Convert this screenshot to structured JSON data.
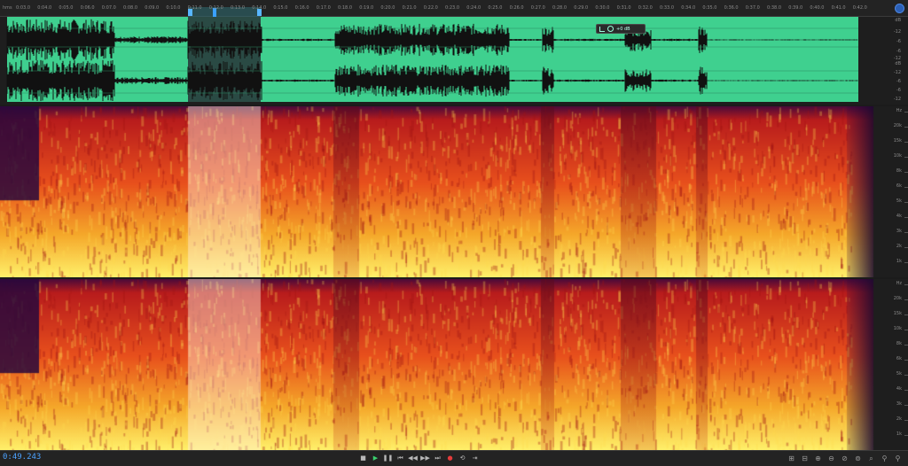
{
  "ruler": {
    "unit_label": "hms",
    "ticks": [
      {
        "label": "0:03.0"
      },
      {
        "label": "0:04.0"
      },
      {
        "label": "0:05.0"
      },
      {
        "label": "0:06.0"
      },
      {
        "label": "0:07.0"
      },
      {
        "label": "0:08.0"
      },
      {
        "label": "0:09.0"
      },
      {
        "label": "0:10.0"
      },
      {
        "label": "0:11.0"
      },
      {
        "label": "0:12.0"
      },
      {
        "label": "0:13.0"
      },
      {
        "label": "0:14.0"
      },
      {
        "label": "0:15.0"
      },
      {
        "label": "0:16.0"
      },
      {
        "label": "0:17.0"
      },
      {
        "label": "0:18.0"
      },
      {
        "label": "0:19.0"
      },
      {
        "label": "0:20.0"
      },
      {
        "label": "0:21.0"
      },
      {
        "label": "0:22.0"
      },
      {
        "label": "0:23.0"
      },
      {
        "label": "0:24.0"
      },
      {
        "label": "0:25.0"
      },
      {
        "label": "0:26.0"
      },
      {
        "label": "0:27.0"
      },
      {
        "label": "0:28.0"
      },
      {
        "label": "0:29.0"
      },
      {
        "label": "0:30.0"
      },
      {
        "label": "0:31.0"
      },
      {
        "label": "0:32.0"
      },
      {
        "label": "0:33.0"
      },
      {
        "label": "0:34.0"
      },
      {
        "label": "0:35.0"
      },
      {
        "label": "0:36.0"
      },
      {
        "label": "0:37.0"
      },
      {
        "label": "0:38.0"
      },
      {
        "label": "0:39.0"
      },
      {
        "label": "0:40.0"
      },
      {
        "label": "0:41.0"
      },
      {
        "label": "0:42.0"
      }
    ]
  },
  "hud": {
    "value": "+0 dB"
  },
  "waveform": {
    "color": "#3fd08f",
    "db_scale": [
      "dB",
      "-12",
      "-6",
      "-6",
      "-12",
      "dB",
      "-12",
      "-6",
      "-6",
      "-12"
    ]
  },
  "spectral": {
    "hz_scale_top": [
      "Hz",
      "20k",
      "15k",
      "10k",
      "8k",
      "6k",
      "5k",
      "4k",
      "3k",
      "2k",
      "1k"
    ],
    "hz_scale_bottom": [
      "Hz",
      "20k",
      "15k",
      "10k",
      "8k",
      "6k",
      "5k",
      "4k",
      "3k",
      "2k",
      "1k"
    ]
  },
  "bottom": {
    "timecode": "0:49.243",
    "transport": [
      {
        "name": "stop-icon",
        "glyph": "■"
      },
      {
        "name": "play-icon",
        "glyph": "▶"
      },
      {
        "name": "pause-icon",
        "glyph": "❚❚"
      },
      {
        "name": "go-to-start-icon",
        "glyph": "⏮"
      },
      {
        "name": "rewind-icon",
        "glyph": "◀◀"
      },
      {
        "name": "fast-forward-icon",
        "glyph": "▶▶"
      },
      {
        "name": "go-to-end-icon",
        "glyph": "⏭"
      },
      {
        "name": "record-icon",
        "glyph": "●"
      },
      {
        "name": "loop-icon",
        "glyph": "⟲"
      },
      {
        "name": "skip-selection-icon",
        "glyph": "⇥"
      }
    ],
    "zoom_tools": [
      {
        "name": "zoom-in-amplitude-icon",
        "glyph": "⊞"
      },
      {
        "name": "zoom-out-amplitude-icon",
        "glyph": "⊟"
      },
      {
        "name": "zoom-in-time-icon",
        "glyph": "⊕"
      },
      {
        "name": "zoom-out-time-icon",
        "glyph": "⊖"
      },
      {
        "name": "zoom-in-playhead-icon",
        "glyph": "⊘"
      },
      {
        "name": "zoom-out-full-icon",
        "glyph": "⊚"
      },
      {
        "name": "zoom-selection-icon",
        "glyph": "⌕"
      },
      {
        "name": "zoom-in-icon",
        "glyph": "⚲"
      },
      {
        "name": "zoom-out-icon",
        "glyph": "⚲"
      }
    ]
  }
}
